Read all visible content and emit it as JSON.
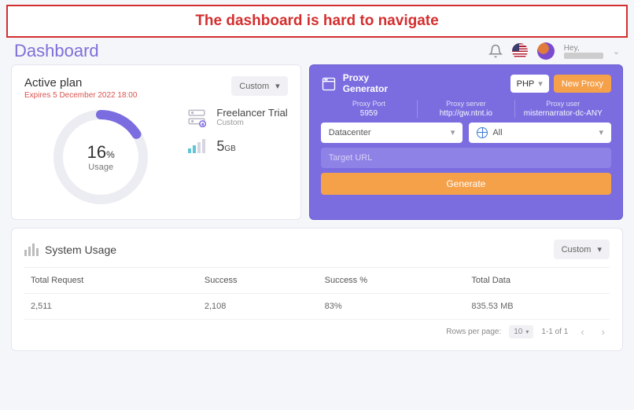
{
  "banner": "The dashboard is hard to navigate",
  "page_title": "Dashboard",
  "greeting": "Hey,",
  "plan": {
    "title": "Active plan",
    "expiry": "Expires 5 December 2022 18:00",
    "dropdown": "Custom",
    "usage_percent": "16",
    "percent_sign": "%",
    "usage_label": "Usage",
    "tier_name": "Freelancer Trial",
    "tier_sub": "Custom",
    "data_amount": "5",
    "data_unit": "GB"
  },
  "proxy": {
    "title_line1": "Proxy",
    "title_line2": "Generator",
    "lang": "PHP",
    "new_button": "New Proxy",
    "stats": {
      "port_label": "Proxy Port",
      "port_value": "5959",
      "server_label": "Proxy server",
      "server_value": "http://gw.ntnt.io",
      "user_label": "Proxy user",
      "user_value": "misternarrator-dc-ANY"
    },
    "select_type": "Datacenter",
    "select_region": "All",
    "target_placeholder": "Target URL",
    "generate": "Generate"
  },
  "system": {
    "title": "System Usage",
    "dropdown": "Custom",
    "columns": [
      "Total Request",
      "Success",
      "Success %",
      "Total Data"
    ],
    "row": [
      "2,511",
      "2,108",
      "83%",
      "835.53 MB"
    ],
    "rows_per_page_label": "Rows per page:",
    "rows_per_page_value": "10",
    "page_info": "1-1 of 1"
  }
}
